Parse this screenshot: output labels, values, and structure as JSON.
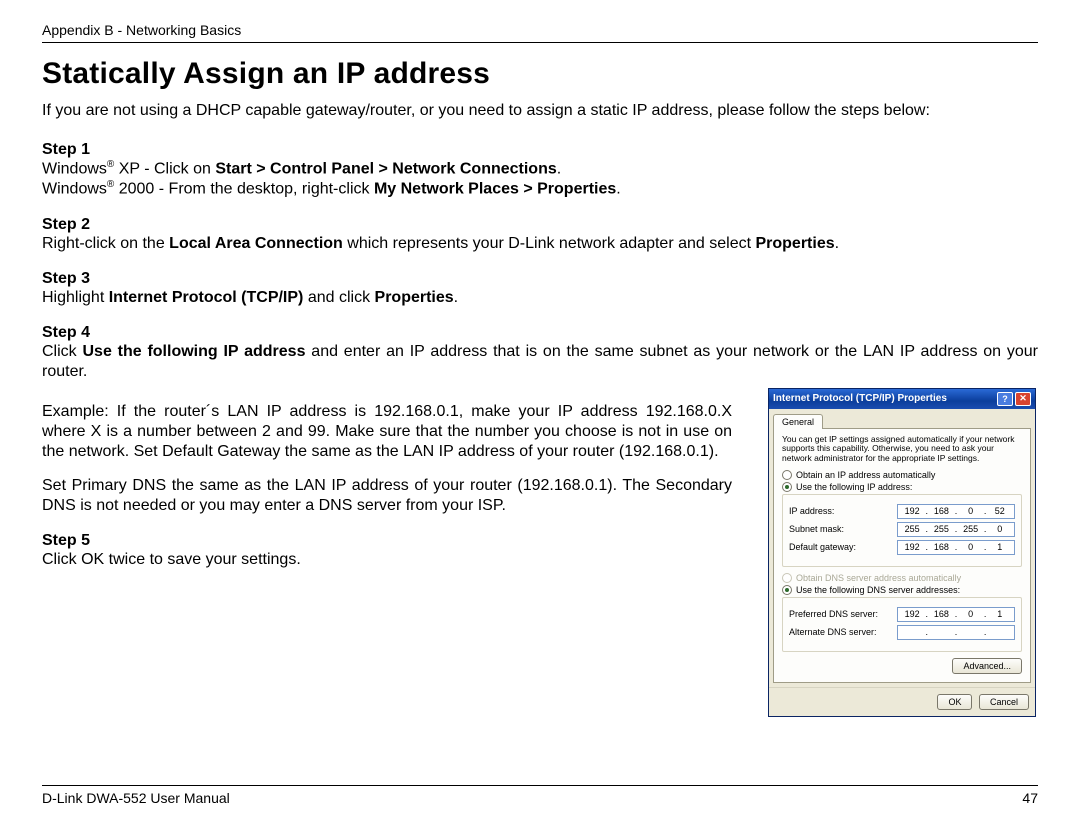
{
  "header": {
    "label": "Appendix B - Networking Basics"
  },
  "title": "Statically Assign an IP address",
  "intro": "If you are not using a DHCP capable gateway/router, or you need to assign a static IP address, please follow the steps below:",
  "step1": {
    "label": "Step 1",
    "line1_prefix": "Windows",
    "line1_sup": "®",
    "line1_mid": " XP - Click on ",
    "line1_bold": "Start > Control Panel > Network Connections",
    "line1_end": ".",
    "line2_prefix": "Windows",
    "line2_sup": "®",
    "line2_mid": " 2000 - From the desktop, right-click ",
    "line2_bold": "My Network Places > Properties",
    "line2_end": "."
  },
  "step2": {
    "label": "Step 2",
    "pre": "Right-click on the ",
    "bold1": "Local Area Connection",
    "mid": " which represents your D-Link network adapter and select ",
    "bold2": "Properties",
    "end": "."
  },
  "step3": {
    "label": "Step 3",
    "pre": "Highlight ",
    "bold1": "Internet Protocol (TCP/IP)",
    "mid": " and click ",
    "bold2": "Properties",
    "end": "."
  },
  "step4": {
    "label": "Step 4",
    "pre": "Click ",
    "bold": "Use the following IP address",
    "post": " and enter an IP address that is on the same subnet as your network or the LAN IP address on your router.",
    "example": "Example: If the router´s LAN IP address is 192.168.0.1, make your IP address 192.168.0.X where X is a number between 2 and 99. Make sure that the number you choose is not in use on the network. Set Default Gateway the same as the LAN IP address of your router (192.168.0.1).",
    "dns": "Set Primary DNS the same as the LAN IP address of your router (192.168.0.1). The Secondary DNS is not needed or you may enter a DNS server from your ISP."
  },
  "step5": {
    "label": "Step 5",
    "body": "Click OK twice to save your settings."
  },
  "dialog": {
    "title": "Internet Protocol (TCP/IP) Properties",
    "help_glyph": "?",
    "close_glyph": "✕",
    "tab": "General",
    "desc": "You can get IP settings assigned automatically if your network supports this capability. Otherwise, you need to ask your network administrator for the appropriate IP settings.",
    "radio_auto_ip": "Obtain an IP address automatically",
    "radio_use_ip": "Use the following IP address:",
    "lbl_ip": "IP address:",
    "lbl_mask": "Subnet mask:",
    "lbl_gw": "Default gateway:",
    "radio_auto_dns": "Obtain DNS server address automatically",
    "radio_use_dns": "Use the following DNS server addresses:",
    "lbl_pdns": "Preferred DNS server:",
    "lbl_adns": "Alternate DNS server:",
    "ip": [
      "192",
      "168",
      "0",
      "52"
    ],
    "mask": [
      "255",
      "255",
      "255",
      "0"
    ],
    "gw": [
      "192",
      "168",
      "0",
      "1"
    ],
    "pdns": [
      "192",
      "168",
      "0",
      "1"
    ],
    "adns": [
      "",
      "",
      "",
      ""
    ],
    "btn_adv": "Advanced...",
    "btn_ok": "OK",
    "btn_cancel": "Cancel"
  },
  "footer": {
    "manual": "D-Link DWA-552 User Manual",
    "page": "47"
  }
}
